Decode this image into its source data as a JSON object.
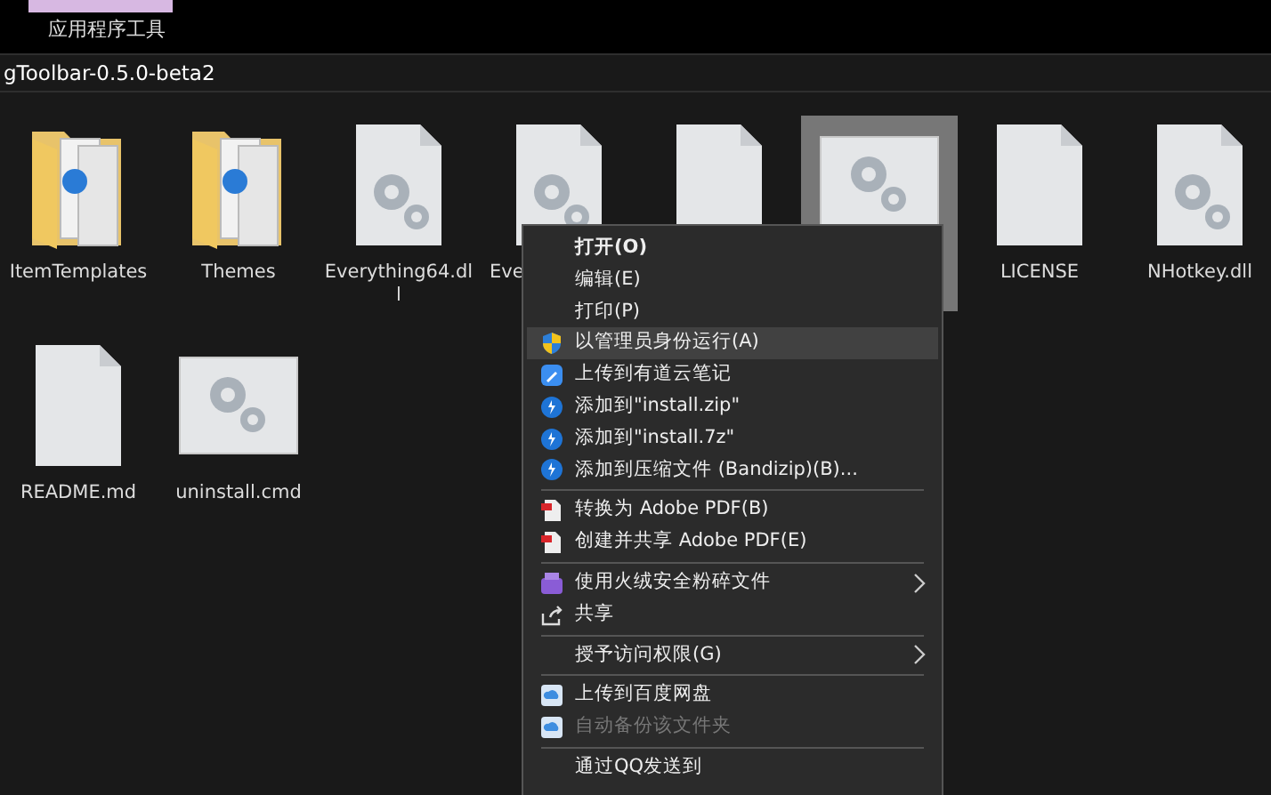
{
  "ribbon": {
    "tab_group_label": "应用程序工具"
  },
  "address_bar": {
    "path": "gToolbar-0.5.0-beta2"
  },
  "files": [
    {
      "kind": "folder",
      "name": "ItemTemplates",
      "selected": false
    },
    {
      "kind": "folder",
      "name": "Themes",
      "selected": false
    },
    {
      "kind": "dll",
      "name": "Everything64.dll",
      "selected": false
    },
    {
      "kind": "dll",
      "name": "Eve",
      "selected": false
    },
    {
      "kind": "file",
      "selected": false
    },
    {
      "kind": "exe",
      "selected": true
    },
    {
      "kind": "file",
      "name": "LICENSE",
      "selected": false
    },
    {
      "kind": "dll",
      "name": "NHotkey.dll",
      "selected": false
    },
    {
      "kind": "file",
      "name": "README.md",
      "selected": false
    },
    {
      "kind": "exe",
      "name": "uninstall.cmd",
      "selected": false
    }
  ],
  "context_menu": [
    {
      "kind": "plain",
      "label": "打开(O)",
      "default": true,
      "selected": false,
      "disabled": false,
      "submenu": false
    },
    {
      "kind": "plain",
      "label": "编辑(E)",
      "default": false,
      "selected": false,
      "disabled": false,
      "submenu": false
    },
    {
      "kind": "plain",
      "label": "打印(P)",
      "default": false,
      "selected": false,
      "disabled": false,
      "submenu": false
    },
    {
      "kind": "shield",
      "label": "以管理员身份运行(A)",
      "default": false,
      "selected": true,
      "disabled": false,
      "submenu": false
    },
    {
      "kind": "note",
      "label": "上传到有道云笔记",
      "default": false,
      "selected": false,
      "disabled": false,
      "submenu": false
    },
    {
      "kind": "zip",
      "label": "添加到\"install.zip\"",
      "default": false,
      "selected": false,
      "disabled": false,
      "submenu": false
    },
    {
      "kind": "zip",
      "label": "添加到\"install.7z\"",
      "default": false,
      "selected": false,
      "disabled": false,
      "submenu": false
    },
    {
      "kind": "zip",
      "label": "添加到压缩文件 (Bandizip)(B)...",
      "default": false,
      "selected": false,
      "disabled": false,
      "submenu": false
    },
    {
      "kind": "separator"
    },
    {
      "kind": "pdf",
      "label": "转换为 Adobe PDF(B)",
      "default": false,
      "selected": false,
      "disabled": false,
      "submenu": false
    },
    {
      "kind": "pdf",
      "label": "创建并共享 Adobe PDF(E)",
      "default": false,
      "selected": false,
      "disabled": false,
      "submenu": false
    },
    {
      "kind": "separator"
    },
    {
      "kind": "shredder",
      "label": "使用火绒安全粉碎文件",
      "default": false,
      "selected": false,
      "disabled": false,
      "submenu": true
    },
    {
      "kind": "share",
      "label": "共享",
      "default": false,
      "selected": false,
      "disabled": false,
      "submenu": false
    },
    {
      "kind": "separator"
    },
    {
      "kind": "plain",
      "label": "授予访问权限(G)",
      "default": false,
      "selected": false,
      "disabled": false,
      "submenu": true
    },
    {
      "kind": "separator"
    },
    {
      "kind": "cloud",
      "label": "上传到百度网盘",
      "default": false,
      "selected": false,
      "disabled": false,
      "submenu": false
    },
    {
      "kind": "cloud",
      "label": "自动备份该文件夹",
      "default": false,
      "selected": false,
      "disabled": true,
      "submenu": false
    },
    {
      "kind": "separator"
    },
    {
      "kind": "plain",
      "label": "通过QQ发送到",
      "default": false,
      "selected": false,
      "disabled": false,
      "submenu": false
    }
  ]
}
